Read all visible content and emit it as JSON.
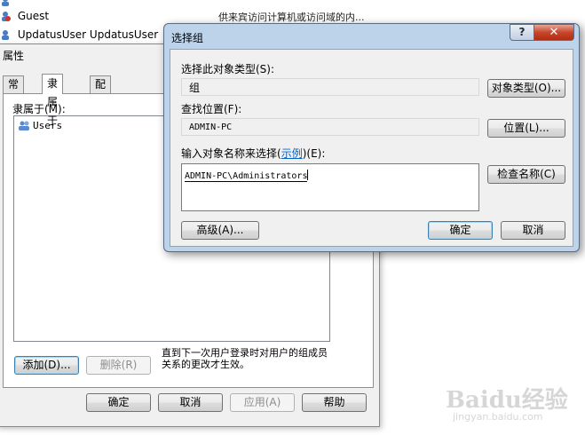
{
  "background_list": {
    "rows": [
      {
        "name": "Guest",
        "description": "供来宾访问计算机或访问域的内..."
      },
      {
        "name": "UpdatusUser  UpdatusUser",
        "description": ""
      }
    ]
  },
  "properties_window": {
    "title": "属性",
    "tabs": [
      {
        "label": "常规",
        "active": false
      },
      {
        "label": "隶属于",
        "active": true
      },
      {
        "label": "配置文件",
        "active": false
      }
    ],
    "member_of_label": "隶属于(M):",
    "members": [
      "Users"
    ],
    "add_button": "添加(D)...",
    "remove_button": "删除(R)",
    "note": "直到下一次用户登录时对用户的组成员关系的更改才生效。",
    "ok_button": "确定",
    "cancel_button": "取消",
    "apply_button": "应用(A)",
    "help_button": "帮助"
  },
  "select_group_dialog": {
    "title": "选择组",
    "help_glyph": "?",
    "close_glyph": "✕",
    "object_type_label": "选择此对象类型(S):",
    "object_type_value": "组",
    "object_types_button": "对象类型(O)...",
    "location_label": "查找位置(F):",
    "location_value": "ADMIN-PC",
    "locations_button": "位置(L)...",
    "names_label_prefix": "输入对象名称来选择(",
    "names_label_link": "示例",
    "names_label_suffix": ")(E):",
    "names_value": "ADMIN-PC\\Administrators",
    "check_names_button": "检查名称(C)",
    "advanced_button": "高级(A)...",
    "ok_button": "确定",
    "cancel_button": "取消"
  },
  "watermark": {
    "logo_text": "Baidu经验",
    "sub_text": "jingyan.baidu.com"
  },
  "colors": {
    "dialog_frame": "#bcd3ea",
    "close_button": "#c7462c",
    "link": "#0066cc"
  }
}
